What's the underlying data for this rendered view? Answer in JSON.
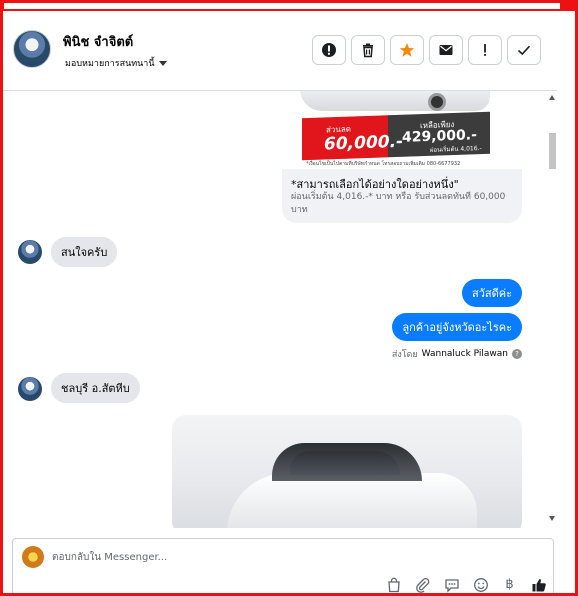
{
  "header": {
    "name": "พินิช จำจิตต์",
    "assign_label": "มอบหมายการสนทนานี้"
  },
  "actions": [
    {
      "name": "mark-spam-button",
      "icon": "exclamation-circle-icon"
    },
    {
      "name": "delete-button",
      "icon": "trash-icon"
    },
    {
      "name": "star-button",
      "icon": "star-icon",
      "color": "#f28a0a"
    },
    {
      "name": "mark-unread-button",
      "icon": "envelope-icon"
    },
    {
      "name": "follow-up-button",
      "icon": "exclamation-icon"
    },
    {
      "name": "mark-done-button",
      "icon": "check-icon"
    }
  ],
  "promo": {
    "discount_label": "ส่วนลด",
    "discount_value": "60,000.-",
    "price_label": "เหลือเพียง",
    "price_value": "429,000.-",
    "monthly": "ผ่อนเริ่มต้น 4,016.- ต่อเดือน",
    "fine_print": "*เงื่อนไขเป็นไปตามที่บริษัทกำหนด โทรสอบถามเพิ่มเติม 080-6677932",
    "title": "*สามารถเลือกได้อย่างใดอย่างหนึ่ง\"",
    "description": "ผ่อนเริ่มต้น 4,016.-* บาท หรือ รับส่วนลดทันที 60,000 บาท"
  },
  "messages": {
    "incoming_1": "สนใจครับ",
    "outgoing_1": "สวัสดีค่ะ",
    "outgoing_2": "ลูกค้าอยู่จังหวัดอะไรคะ",
    "sent_by_label": "ส่งโดย",
    "sent_by_name": "Wannaluck Pilawan",
    "incoming_2": "ชลบุรี อ.สัตหีบ"
  },
  "composer": {
    "placeholder": "ตอบกลับใน Messenger..."
  },
  "composer_tools": [
    "bag-icon",
    "paperclip-icon",
    "chat-bubble-icon",
    "emoji-icon",
    "baht-icon",
    "thumbs-up-icon"
  ],
  "colors": {
    "accent": "#0a7cff",
    "frame": "#ee1111",
    "incoming_bubble": "#e4e6eb"
  }
}
